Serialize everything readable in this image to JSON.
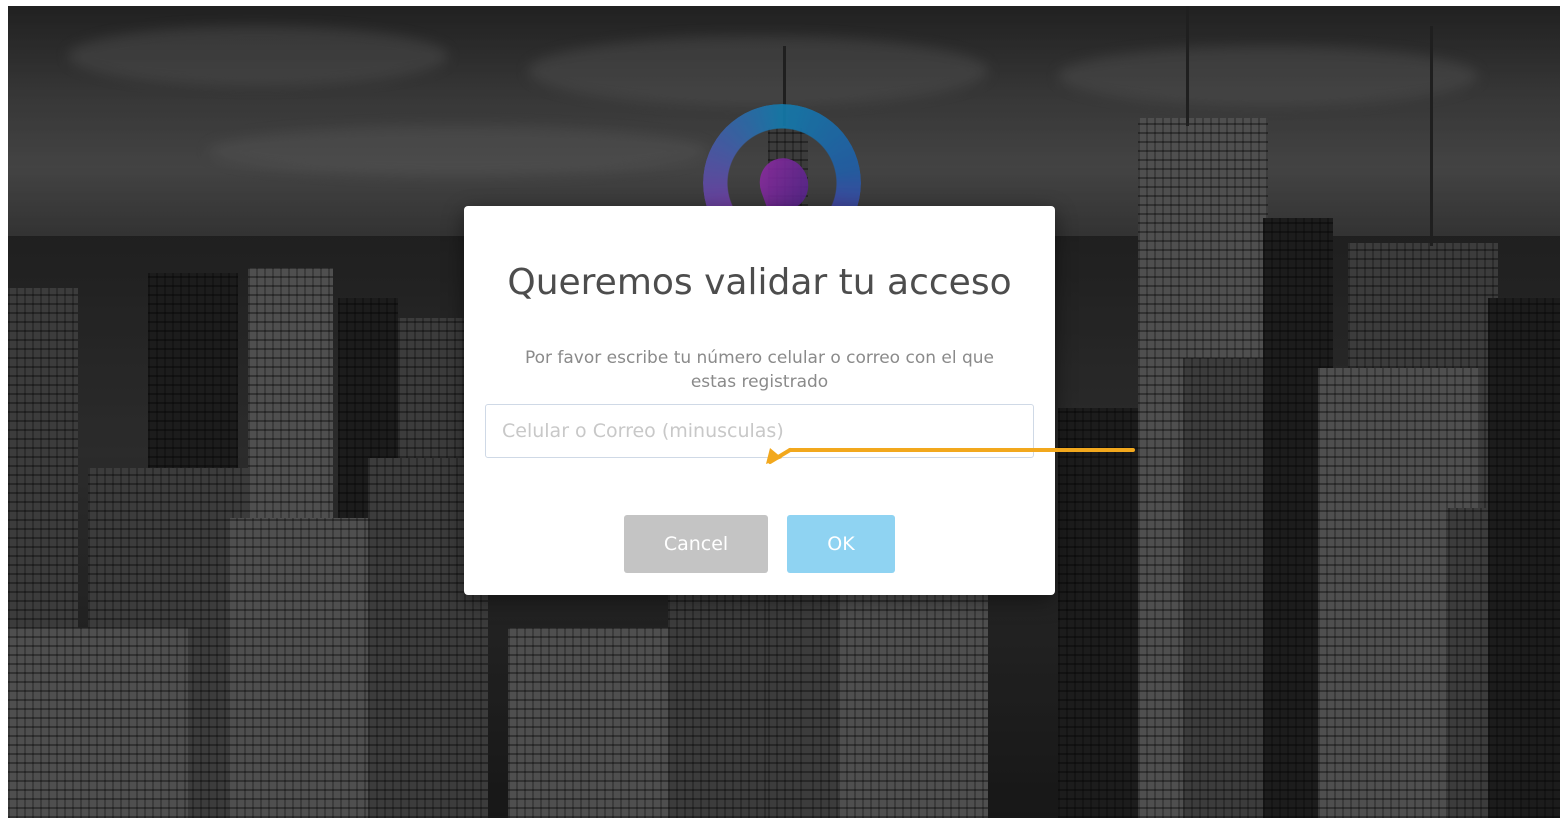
{
  "dialog": {
    "title": "Queremos validar tu acceso",
    "message": "Por favor escribe tu número celular o correo con el que estas registrado",
    "input": {
      "placeholder": "Celular o Correo (minusculas)",
      "value": ""
    },
    "buttons": {
      "cancel_label": "Cancel",
      "ok_label": "OK"
    }
  },
  "colors": {
    "cancel_button": "#c4c4c4",
    "ok_button": "#8fd3f2",
    "annotation_arrow": "#f2a81d",
    "logo_primary": "#1aa6e8",
    "logo_secondary": "#c13ad9"
  },
  "icons": {
    "background_logo": "brand-ring-logo-icon",
    "annotation": "arrow-annotation-icon"
  }
}
